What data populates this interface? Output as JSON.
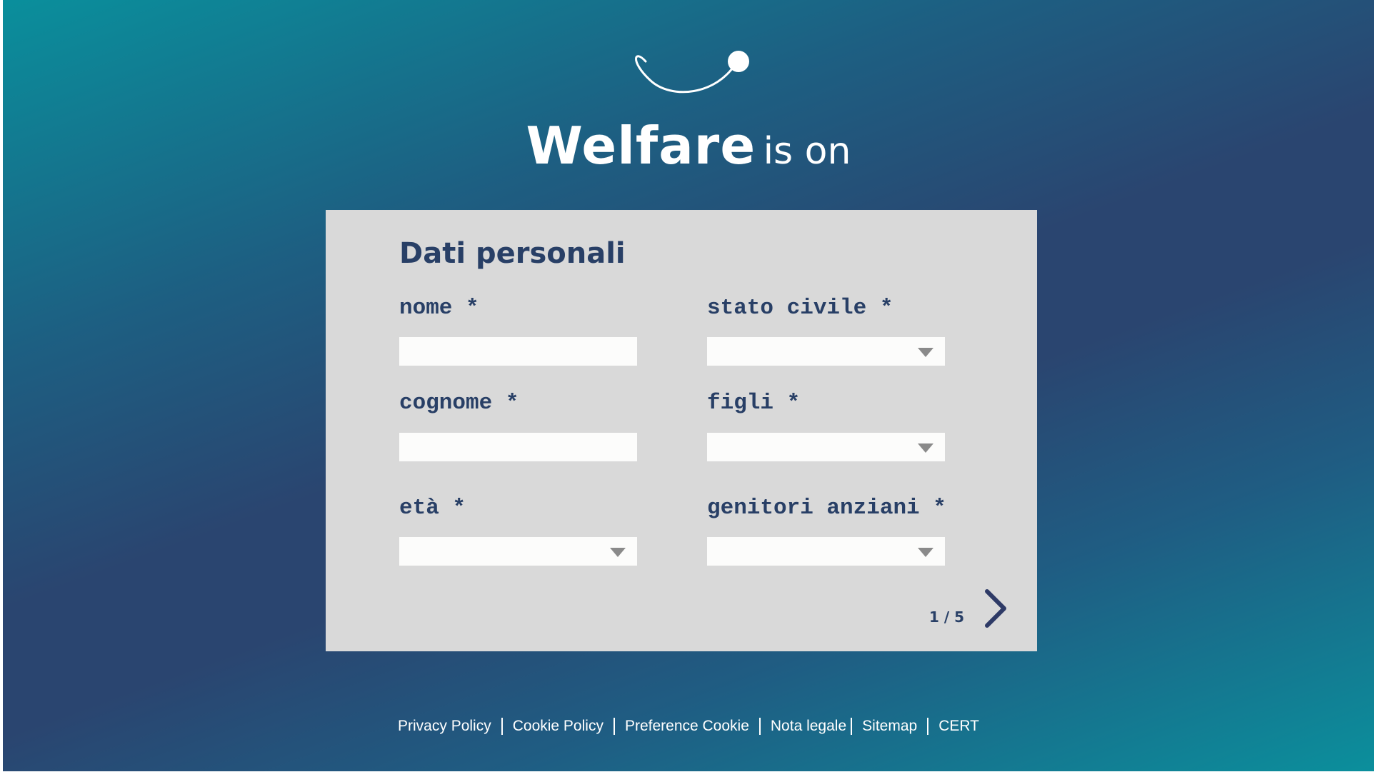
{
  "brand": {
    "name_main": "Welfare",
    "name_suffix": "is on"
  },
  "form": {
    "title": "Dati personali",
    "fields": {
      "nome": {
        "label": "nome *",
        "value": ""
      },
      "cognome": {
        "label": "cognome *",
        "value": ""
      },
      "eta": {
        "label": "età *",
        "value": ""
      },
      "stato_civile": {
        "label": "stato civile *",
        "value": ""
      },
      "figli": {
        "label": "figli *",
        "value": ""
      },
      "genitori_anziani": {
        "label": "genitori anziani *",
        "value": ""
      }
    },
    "pager": "1 / 5"
  },
  "footer": {
    "links": [
      "Privacy Policy",
      "Cookie Policy",
      "Preference Cookie",
      "Nota legale",
      "Sitemap",
      "CERT"
    ]
  },
  "colors": {
    "text_dark": "#283f66",
    "card_bg": "#d9d9d9",
    "gradient_teal": "#0a8f9c",
    "gradient_navy": "#2a4570"
  },
  "icons": {
    "logo": "smile-logo-icon",
    "next": "chevron-right-icon",
    "dropdown": "triangle-down-icon"
  }
}
